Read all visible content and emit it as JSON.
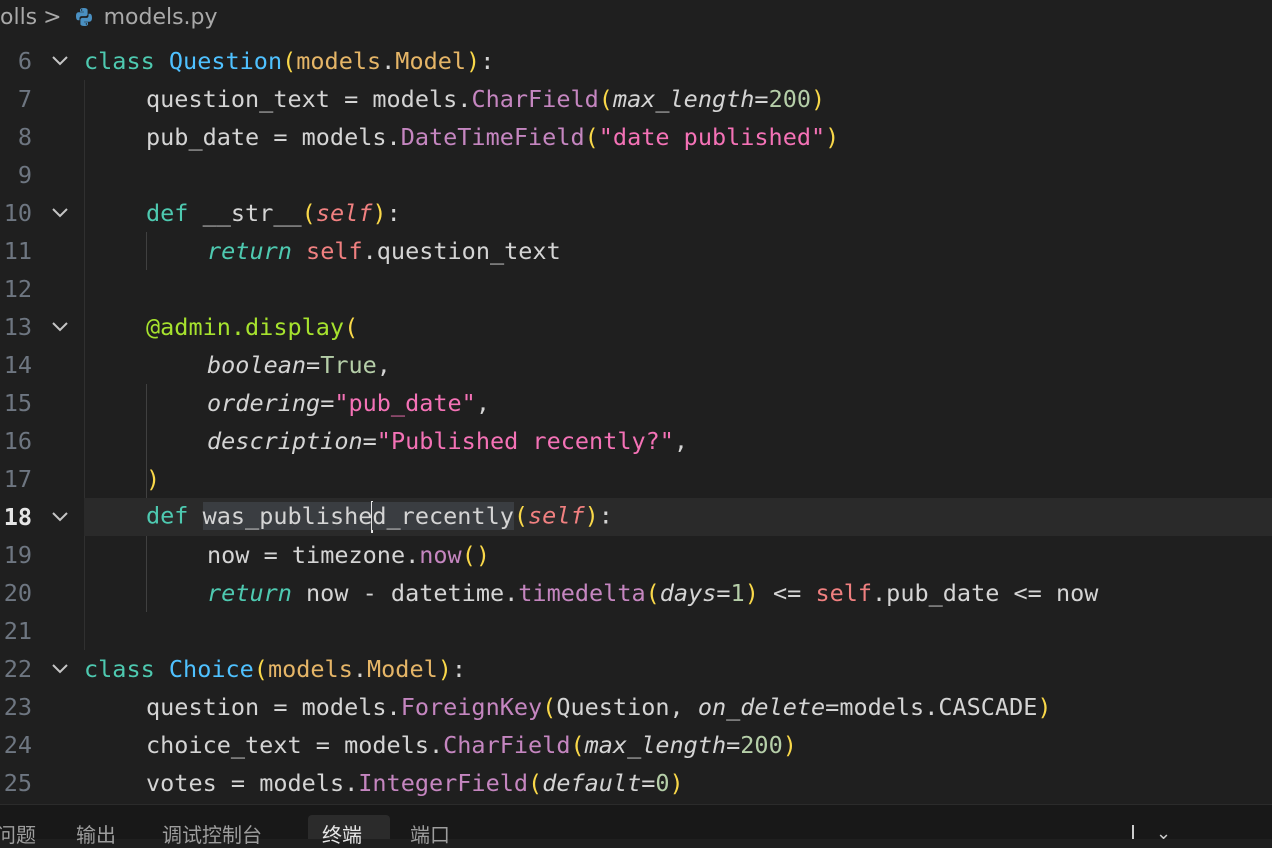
{
  "breadcrumb": {
    "folder": "olls",
    "separator": ">",
    "file": "models.py",
    "file_icon": "python-icon"
  },
  "editor": {
    "current_line": 18,
    "lines": [
      {
        "n": "6",
        "fold": true
      },
      {
        "n": "7"
      },
      {
        "n": "8"
      },
      {
        "n": "9"
      },
      {
        "n": "10",
        "fold": true
      },
      {
        "n": "11"
      },
      {
        "n": "12"
      },
      {
        "n": "13",
        "fold": true
      },
      {
        "n": "14"
      },
      {
        "n": "15"
      },
      {
        "n": "16"
      },
      {
        "n": "17"
      },
      {
        "n": "18",
        "fold": true
      },
      {
        "n": "19"
      },
      {
        "n": "20"
      },
      {
        "n": "21"
      },
      {
        "n": "22",
        "fold": true
      },
      {
        "n": "23"
      },
      {
        "n": "24"
      },
      {
        "n": "25"
      }
    ],
    "code": {
      "l6": {
        "class": "class",
        "name": "Question",
        "base": "models",
        "dot": ".",
        "basecls": "Model",
        "colon": ":"
      },
      "l7": {
        "var": "question_text",
        "eq": " = ",
        "mod": "models",
        "fn": "CharField",
        "param": "max_length",
        "val": "200"
      },
      "l8": {
        "var": "pub_date",
        "eq": " = ",
        "mod": "models",
        "fn": "DateTimeField",
        "str": "\"date published\""
      },
      "l10": {
        "def": "def",
        "name": "__str__",
        "self": "self"
      },
      "l11": {
        "ret": "return",
        "self": "self",
        "attr": ".question_text"
      },
      "l13": {
        "deco": "@admin",
        "attr": ".display"
      },
      "l14": {
        "param": "boolean",
        "val": "True"
      },
      "l15": {
        "param": "ordering",
        "str": "\"pub_date\""
      },
      "l16": {
        "param": "description",
        "str": "\"Published recently?\""
      },
      "l17": {
        "close": ")"
      },
      "l18": {
        "def": "def",
        "name_a": "was_publishe",
        "name_b": "d_recently",
        "self": "self"
      },
      "l19": {
        "var": "now",
        "eq": " = ",
        "mod": "timezone",
        "fn": "now"
      },
      "l20": {
        "ret": "return",
        "a": " now - datetime",
        "fn": "timedelta",
        "param": "days",
        "val": "1",
        "b": " <= ",
        "self": "self",
        "c": ".pub_date <= now"
      },
      "l22": {
        "class": "class",
        "name": "Choice",
        "base": "models",
        "dot": ".",
        "basecls": "Model"
      },
      "l23": {
        "var": "question",
        "eq": " = ",
        "mod": "models",
        "fn": "ForeignKey",
        "arg": "Question",
        "param": "on_delete",
        "val": "models.CASCADE"
      },
      "l24": {
        "var": "choice_text",
        "eq": " = ",
        "mod": "models",
        "fn": "CharField",
        "param": "max_length",
        "val": "200"
      },
      "l25": {
        "var": "votes",
        "eq": " = ",
        "mod": "models",
        "fn": "IntegerField",
        "param": "default",
        "val": "0"
      }
    }
  },
  "panel": {
    "tabs": [
      "问题",
      "输出",
      "调试控制台",
      "终端",
      "端口"
    ],
    "active_tab": "终端"
  }
}
